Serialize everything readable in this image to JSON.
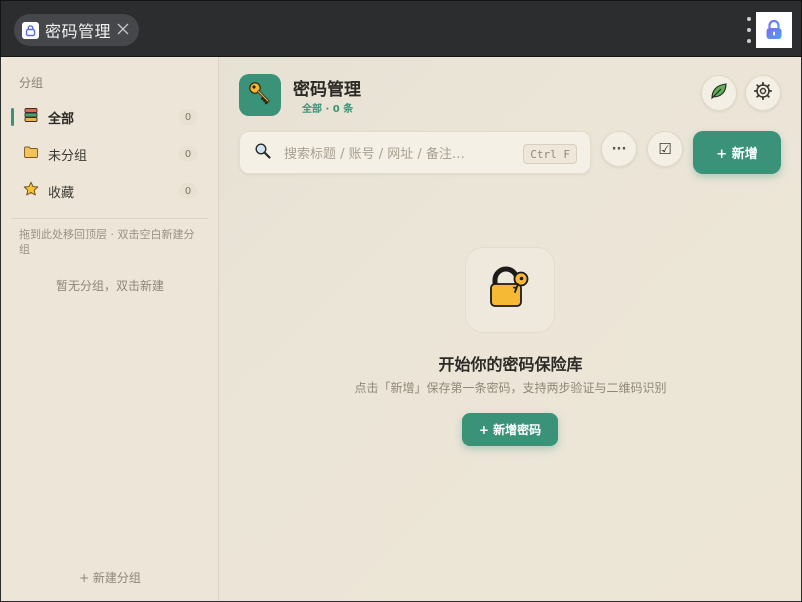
{
  "browser": {
    "tab_title": "密码管理"
  },
  "sidebar": {
    "header": "分组",
    "items": [
      {
        "label": "全部",
        "count": "0",
        "icon": "stack-icon"
      },
      {
        "label": "未分组",
        "count": "0",
        "icon": "folder-icon"
      },
      {
        "label": "收藏",
        "count": "0",
        "icon": "star-icon"
      }
    ],
    "hint": "拖到此处移回顶层 · 双击空白新建分组",
    "empty_text": "暂无分组，双击新建",
    "new_group": "+ 新建分组"
  },
  "header": {
    "title": "密码管理",
    "subtitle": "全部 · 0 条"
  },
  "toolbar": {
    "search_placeholder": "搜索标题 / 账号 / 网址 / 备注…",
    "shortcut": "Ctrl F",
    "more_label": "···",
    "select_label": "☑",
    "new_label": "+  新增"
  },
  "empty_state": {
    "title": "开始你的密码保险库",
    "description": "点击「新增」保存第一条密码，支持两步验证与二维码识别",
    "button": "+ 新增密码"
  },
  "colors": {
    "accent": "#3a9378",
    "background": "#ebe5d7",
    "titlebar": "#2c2d2f"
  }
}
